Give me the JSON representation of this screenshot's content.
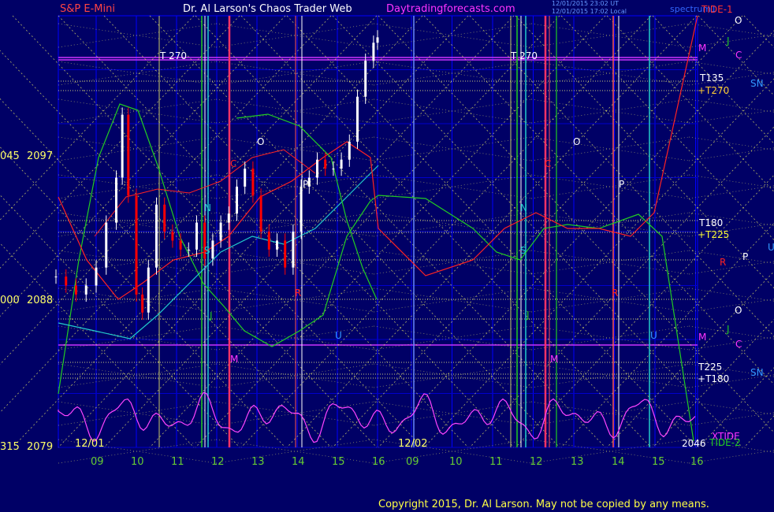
{
  "header": {
    "symbol": "S&P E-Mini",
    "title": "Dr. Al Larson's Chaos Trader Web",
    "site": "Daytradingforecasts.com",
    "stamp1": "12/01/2015 23:02 UT",
    "stamp2": "12/01/2015 17:02 Local",
    "spectrum_label": "spectrum1"
  },
  "copyright": "Copyright 2015, Dr. Al Larson. May not be copied by any means.",
  "colors": {
    "background": "#000066",
    "price_up": "#ffffff",
    "price_down": "#ff0000",
    "flux_yellow": "#ffff66",
    "cycle_magenta": "#ff44ff",
    "tide_red": "#ff2222",
    "green_band": "#22cc22",
    "cyan_band": "#22cccc",
    "grid": "#0000ff",
    "axis_label": "#66cc33",
    "header_red": "#ff4444",
    "header_white": "#ffffff",
    "header_magenta": "#ff33ff"
  },
  "chart_data": {
    "type": "candlestick",
    "title": "S&P E-Mini",
    "x_tick_labels": [
      "09",
      "10",
      "11",
      "12",
      "13",
      "14",
      "15",
      "16",
      "09",
      "10",
      "11",
      "12",
      "13",
      "14",
      "15",
      "16"
    ],
    "date_labels": [
      "12/01",
      "12/02"
    ],
    "y_axis": [
      {
        "left": "045",
        "right": "2097"
      },
      {
        "left": "000",
        "right": "2088"
      },
      {
        "left": "315",
        "right": "2079"
      }
    ],
    "ylim": [
      2079,
      2103
    ],
    "price_series": {
      "name": "S&P E-Mini 5-min",
      "x_hours_day1": [
        8.0,
        8.25,
        8.5,
        8.75,
        9.0,
        9.25,
        9.5,
        9.65,
        9.8,
        10.0,
        10.15,
        10.3,
        10.5,
        10.7,
        10.9,
        11.1,
        11.3,
        11.5,
        11.7,
        11.9,
        12.1,
        12.3,
        12.5,
        12.7,
        12.9,
        13.1,
        13.3,
        13.5,
        13.7,
        13.9,
        14.1,
        14.3,
        14.5,
        14.7,
        14.9,
        15.1,
        15.3,
        15.5,
        15.7,
        15.9,
        16.0
      ],
      "close": [
        2088.5,
        2088.0,
        2087.5,
        2088.0,
        2089.0,
        2091.5,
        2094.0,
        2097.5,
        2093.0,
        2087.5,
        2086.5,
        2089.0,
        2092.5,
        2091.0,
        2090.5,
        2090.0,
        2090.0,
        2091.5,
        2089.5,
        2090.5,
        2091.5,
        2092.0,
        2093.5,
        2094.5,
        2093.0,
        2091.0,
        2090.0,
        2090.5,
        2089.0,
        2091.0,
        2093.5,
        2094.0,
        2095.0,
        2094.5,
        2094.5,
        2095.0,
        2096.0,
        2098.5,
        2100.5,
        2101.5,
        2101.8
      ]
    },
    "right_labels": [
      {
        "text": "TIDE-1",
        "color": "#ff3333"
      },
      {
        "text": "O",
        "color": "#ffffff"
      },
      {
        "text": "J",
        "color": "#22cc22"
      },
      {
        "text": "M",
        "color": "#ff33ff"
      },
      {
        "text": "C",
        "color": "#ff33ff"
      },
      {
        "text": "T135",
        "color": "#ffffff"
      },
      {
        "text": "+T270",
        "color": "#ffcc33"
      },
      {
        "text": "SN",
        "color": "#3399ff"
      },
      {
        "text": "T180",
        "color": "#ffffff"
      },
      {
        "text": "+T225",
        "color": "#ffff33"
      },
      {
        "text": "P",
        "color": "#ffffff"
      },
      {
        "text": "U",
        "color": "#3399ff"
      },
      {
        "text": "R",
        "color": "#ff2222"
      },
      {
        "text": "O",
        "color": "#ffffff"
      },
      {
        "text": "J",
        "color": "#22cc22"
      },
      {
        "text": "M",
        "color": "#ff33ff"
      },
      {
        "text": "C",
        "color": "#ff33ff"
      },
      {
        "text": "T225",
        "color": "#ffffff"
      },
      {
        "text": "+T180",
        "color": "#ffffff"
      },
      {
        "text": "SN",
        "color": "#3399ff"
      },
      {
        "text": "XTIDE",
        "color": "#ff33ff"
      },
      {
        "text": "TIDE-2",
        "color": "#22cc22"
      },
      {
        "text": "2046",
        "color": "#ffffff"
      }
    ],
    "chart_annotations": [
      {
        "text": "T 270",
        "color": "#ffffff"
      },
      {
        "text": "T 270",
        "color": "#ffffff"
      },
      {
        "text": "O",
        "color": "#ffffff"
      },
      {
        "text": "O",
        "color": "#ffffff"
      },
      {
        "text": "P",
        "color": "#ffffff"
      },
      {
        "text": "P",
        "color": "#ffffff"
      },
      {
        "text": "C",
        "color": "#ff2222"
      },
      {
        "text": "C",
        "color": "#ff2222"
      },
      {
        "text": "N",
        "color": "#22cccc"
      },
      {
        "text": "N",
        "color": "#22cccc"
      },
      {
        "text": "M",
        "color": "#ff33ff"
      },
      {
        "text": "M",
        "color": "#ff33ff"
      },
      {
        "text": "R",
        "color": "#ff2222"
      },
      {
        "text": "R",
        "color": "#ff2222"
      },
      {
        "text": "U",
        "color": "#3399ff"
      },
      {
        "text": "U",
        "color": "#3399ff"
      },
      {
        "text": "J",
        "color": "#22cc22"
      },
      {
        "text": "J",
        "color": "#22cc22"
      },
      {
        "text": "S",
        "color": "#22cccc"
      },
      {
        "text": "S",
        "color": "#22cccc"
      }
    ]
  }
}
